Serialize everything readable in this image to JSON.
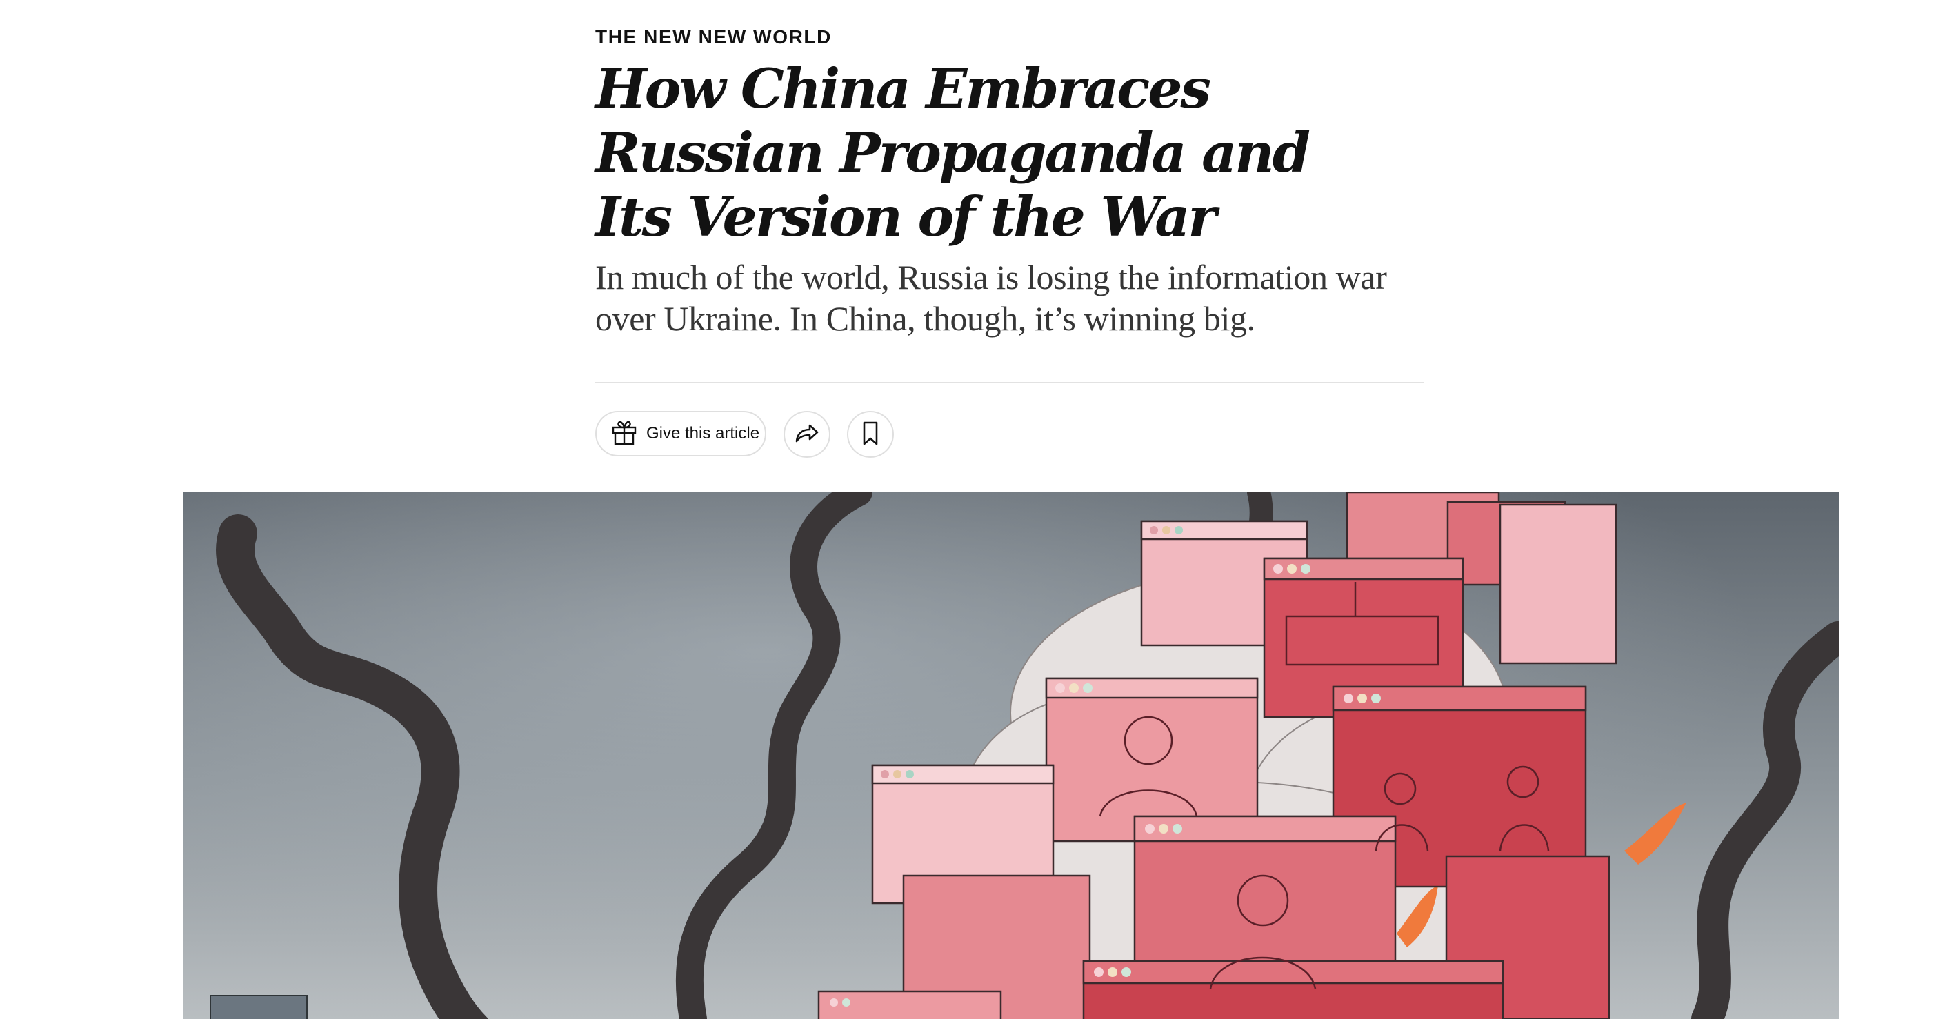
{
  "article": {
    "kicker": "The New New World",
    "headline": "How China Embraces Russian Propaganda and Its Version of the War",
    "summary": "In much of the world, Russia is losing the information war over Ukraine. In China, though, it’s winning big."
  },
  "share_tools": {
    "gift_label": "Give this article",
    "gift_icon": "gift-icon",
    "share_icon": "share-icon",
    "save_icon": "bookmark-icon"
  },
  "illustration": {
    "colors": {
      "sky": "#6f7880",
      "smoke": "#3b3838",
      "screen": "#d4505e",
      "screen_light": "#f0a9b0",
      "fire": "#f07a3c"
    }
  }
}
